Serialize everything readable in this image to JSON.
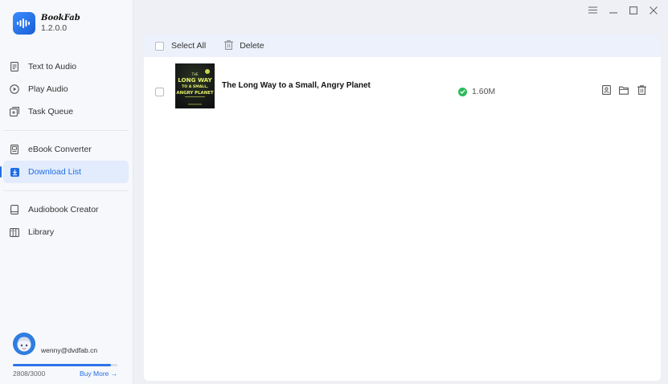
{
  "app": {
    "name": "BookFab",
    "version": "1.2.0.0"
  },
  "sidebar": {
    "groups": [
      [
        {
          "id": "text-to-audio",
          "label": "Text to Audio",
          "icon": "document-icon"
        },
        {
          "id": "play-audio",
          "label": "Play Audio",
          "icon": "play-circle-icon"
        },
        {
          "id": "task-queue",
          "label": "Task Queue",
          "icon": "queue-icon"
        }
      ],
      [
        {
          "id": "ebook-converter",
          "label": "eBook Converter",
          "icon": "ebook-icon"
        },
        {
          "id": "download-list",
          "label": "Download List",
          "icon": "download-icon",
          "active": true
        }
      ],
      [
        {
          "id": "audiobook-creator",
          "label": "Audiobook Creator",
          "icon": "book-icon"
        },
        {
          "id": "library",
          "label": "Library",
          "icon": "library-icon"
        }
      ]
    ]
  },
  "account": {
    "email": "wenny@dvdfab.cn",
    "quota_text": "2808/3000",
    "quota_fraction": 0.936,
    "buy_more": "Buy More →"
  },
  "toolbar": {
    "select_all": "Select All",
    "delete": "Delete"
  },
  "downloads": [
    {
      "title": "The Long Way to a Small, Angry Planet",
      "size": "1.60M",
      "status": "completed",
      "cover_lines": [
        "THE",
        "LONG WAY",
        "TO A SMALL,",
        "ANGRY PLANET"
      ]
    }
  ],
  "colors": {
    "accent": "#1f6de6",
    "success": "#2dba5a",
    "panel_header": "#ecf1fb"
  }
}
